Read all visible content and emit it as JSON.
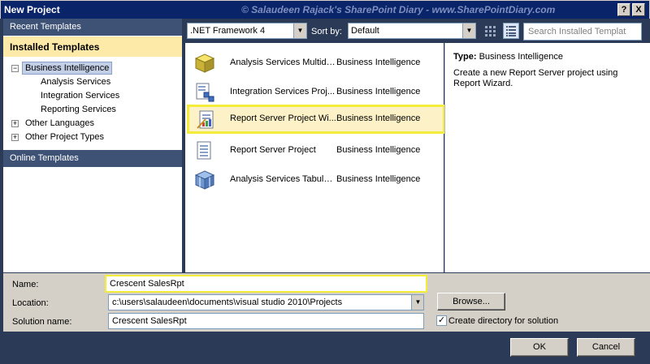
{
  "window": {
    "title": "New Project",
    "watermark": "© Salaudeen Rajack's SharePoint Diary - www.SharePointDiary.com",
    "help_glyph": "?",
    "close_glyph": "X"
  },
  "sidebar": {
    "recent_templates": "Recent Templates",
    "installed_templates": "Installed Templates",
    "online_templates": "Online Templates",
    "tree": [
      {
        "label": "Business Intelligence",
        "toggle": "−",
        "selected": true
      },
      {
        "label": "Analysis Services"
      },
      {
        "label": "Integration Services"
      },
      {
        "label": "Reporting Services"
      },
      {
        "label": "Other Languages",
        "toggle": "+"
      },
      {
        "label": "Other Project Types",
        "toggle": "+"
      }
    ]
  },
  "toolbar": {
    "framework": ".NET Framework 4",
    "sort_by_label": "Sort by:",
    "sort_by_value": "Default",
    "search_placeholder": "Search Installed Templat"
  },
  "templates": [
    {
      "name": "Analysis Services Multidim...",
      "category": "Business Intelligence",
      "icon": "cube-icon"
    },
    {
      "name": "Integration Services Proj...",
      "category": "Business Intelligence",
      "icon": "integration-icon"
    },
    {
      "name": "Report Server Project Wi...",
      "category": "Business Intelligence",
      "icon": "report-wizard-icon",
      "selected": true
    },
    {
      "name": "Report Server Project",
      "category": "Business Intelligence",
      "icon": "report-icon"
    },
    {
      "name": "Analysis Services Tabular...",
      "category": "Business Intelligence",
      "icon": "tabular-icon"
    }
  ],
  "description": {
    "type_label": "Type:",
    "type_value": "Business Intelligence",
    "text": "Create a new Report Server project using Report Wizard."
  },
  "form": {
    "name_label": "Name:",
    "name_value": "Crescent SalesRpt",
    "location_label": "Location:",
    "location_value": "c:\\users\\salaudeen\\documents\\visual studio 2010\\Projects",
    "solution_label": "Solution name:",
    "solution_value": "Crescent SalesRpt",
    "browse_label": "Browse...",
    "create_dir_label": "Create directory for solution",
    "create_dir_checked": "✓"
  },
  "footer": {
    "ok_label": "OK",
    "cancel_label": "Cancel"
  },
  "colors": {
    "title_bar": "#0a246a",
    "frame": "#2b3b57",
    "highlight_border": "#f3ec3a",
    "installed_header": "#fde9a8"
  }
}
